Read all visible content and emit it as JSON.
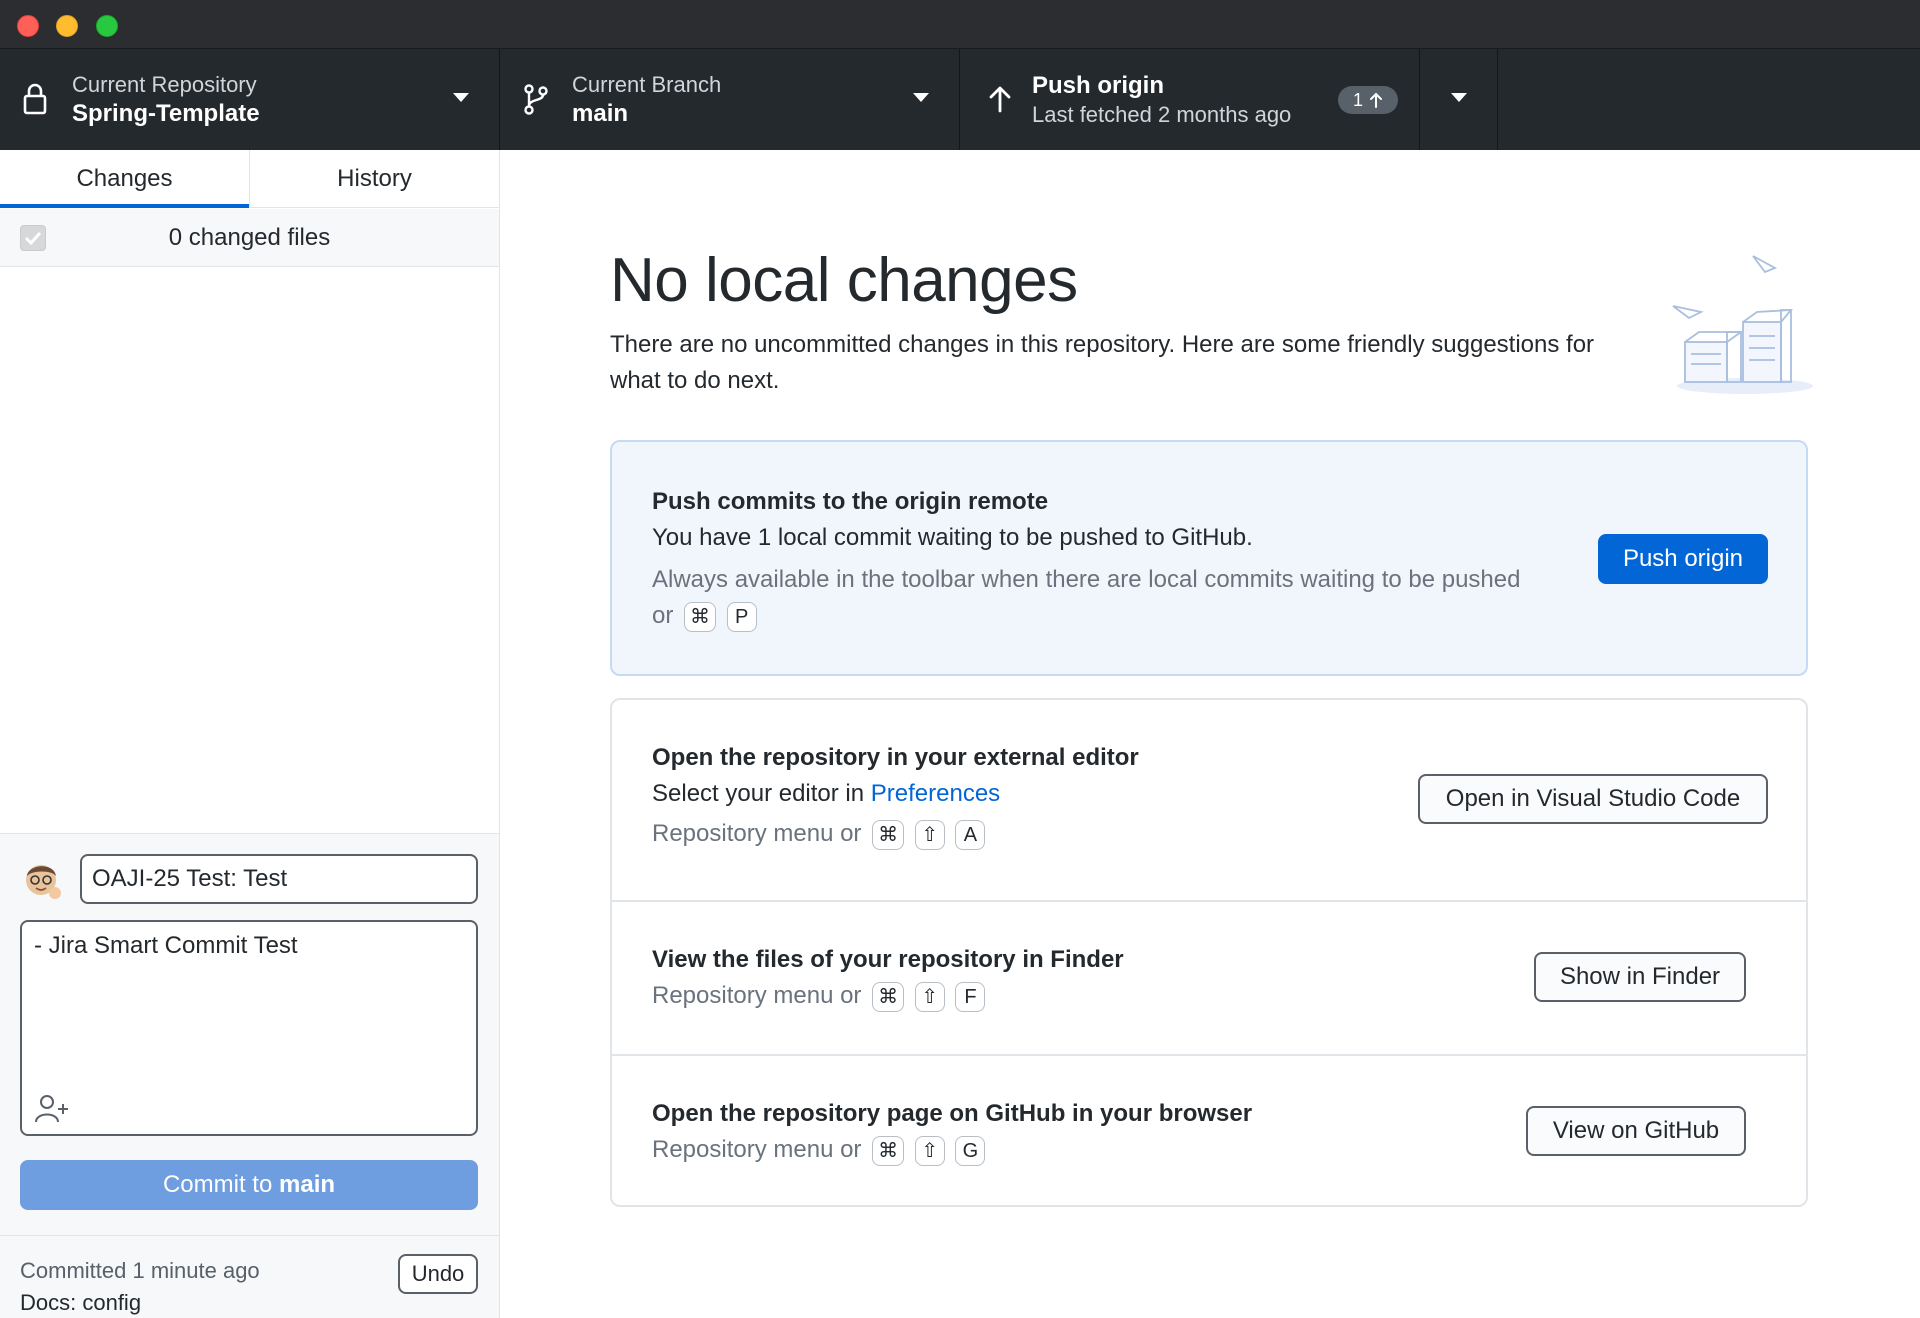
{
  "toolbar": {
    "repo_label": "Current Repository",
    "repo_name": "Spring-Template",
    "branch_label": "Current Branch",
    "branch_name": "main",
    "push_title": "Push origin",
    "push_subtitle": "Last fetched 2 months ago",
    "push_count": "1"
  },
  "sidebar": {
    "tabs": [
      {
        "label": "Changes",
        "active": true
      },
      {
        "label": "History",
        "active": false
      }
    ],
    "changed_files": "0 changed files",
    "commit": {
      "summary_value": "OAJI-25 Test: Test",
      "description_value": "- Jira Smart Commit Test",
      "button_prefix": "Commit to",
      "button_branch": "main"
    },
    "last_commit": {
      "time": "Committed 1 minute ago",
      "message": "Docs: config",
      "undo_label": "Undo"
    }
  },
  "main": {
    "title": "No local changes",
    "subtitle": "There are no uncommitted changes in this repository. Here are some friendly suggestions for what to do next.",
    "push_card": {
      "title": "Push commits to the origin remote",
      "description": "You have 1 local commit waiting to be pushed to GitHub.",
      "hint": "Always available in the toolbar when there are local commits waiting to be pushed or",
      "keys": [
        "⌘",
        "P"
      ],
      "button": "Push origin"
    },
    "suggestions": [
      {
        "title": "Open the repository in your external editor",
        "desc_prefix": "Select your editor in",
        "desc_link": "Preferences",
        "hint": "Repository menu or",
        "keys": [
          "⌘",
          "⇧",
          "A"
        ],
        "button": "Open in Visual Studio Code"
      },
      {
        "title": "View the files of your repository in Finder",
        "hint": "Repository menu or",
        "keys": [
          "⌘",
          "⇧",
          "F"
        ],
        "button": "Show in Finder"
      },
      {
        "title": "Open the repository page on GitHub in your browser",
        "hint": "Repository menu or",
        "keys": [
          "⌘",
          "⇧",
          "G"
        ],
        "button": "View on GitHub"
      }
    ]
  },
  "colors": {
    "toolbar_bg": "#24292e",
    "accent": "#0366d6",
    "commit_button_disabled": "#6e9ee0",
    "push_card_bg": "#f1f6fd"
  },
  "icons": [
    "lock-icon",
    "branch-icon",
    "arrow-up-icon",
    "caret-down-icon",
    "checkbox-icon",
    "avatar",
    "add-coauthor-icon",
    "empty-state-illustration"
  ]
}
